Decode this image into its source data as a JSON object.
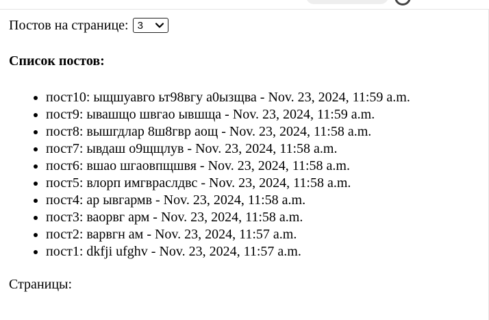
{
  "controls": {
    "per_page_label": "Постов на странице:",
    "per_page_value": "3"
  },
  "list": {
    "heading": "Список постов:",
    "posts": [
      "пост10: ыщшуавго ьт98вгу а0ызщва - Nov. 23, 2024, 11:59 a.m.",
      "пост9: ывашщо швгао ывшща - Nov. 23, 2024, 11:59 a.m.",
      "пост8: вышгдлар 8ш8гвр аощ - Nov. 23, 2024, 11:58 a.m.",
      "пост7: ывдаш о9щщлув - Nov. 23, 2024, 11:58 a.m.",
      "пост6: вшао шгаовпщшвя - Nov. 23, 2024, 11:58 a.m.",
      "пост5: влорп имгврaслдвс - Nov. 23, 2024, 11:58 a.m.",
      "пост4: ар ывгармв - Nov. 23, 2024, 11:58 a.m.",
      "пост3: ваорвг арм - Nov. 23, 2024, 11:58 a.m.",
      "пост2: варвгн ам - Nov. 23, 2024, 11:57 a.m.",
      "пост1: dkfji ufghv - Nov. 23, 2024, 11:57 a.m."
    ]
  },
  "pagination": {
    "label": "Страницы:"
  },
  "icons": {
    "select_arrow": "chevron-down-icon"
  }
}
